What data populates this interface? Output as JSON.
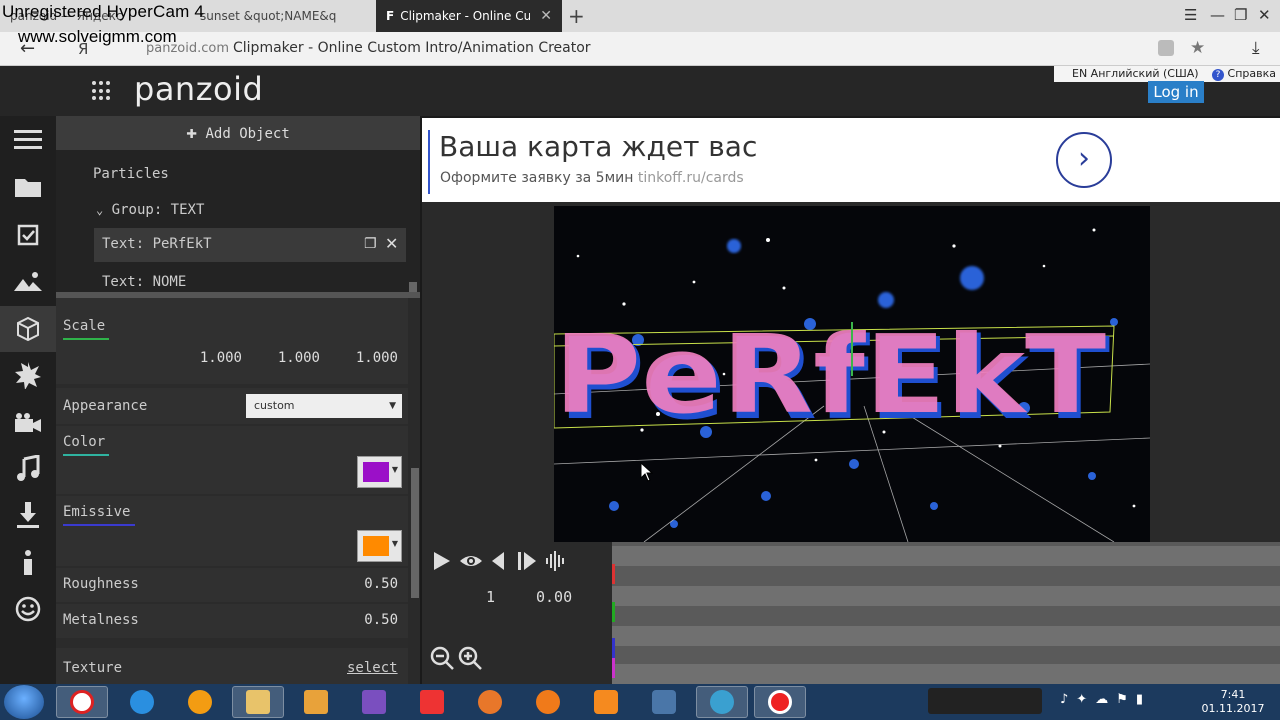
{
  "overlay": {
    "recorder_text": "Unregistered HyperCam 4",
    "recorder_url": "www.solveigmm.com"
  },
  "browser": {
    "tabs": [
      {
        "label": "panzoid — Яндекс",
        "active": false
      },
      {
        "label": "sunset &quot;NAME&q",
        "active": false
      },
      {
        "label": "Clipmaker - Online Custo",
        "active": true
      }
    ],
    "address": {
      "domain": "panzoid.com",
      "title": "Clipmaker - Online Custom Intro/Animation Creator"
    }
  },
  "header": {
    "logo": "panzoid",
    "language": "EN Английский (США)",
    "help": "Справка",
    "login": "Log in"
  },
  "panel": {
    "add_object": "Add Object",
    "tree": {
      "particles": "Particles",
      "group": "Group: TEXT",
      "selected": "Text: PeRfEkT",
      "next": "Text: NOME"
    },
    "properties": {
      "scale_label": "Scale",
      "scale_x": "1.000",
      "scale_y": "1.000",
      "scale_z": "1.000",
      "appearance_label": "Appearance",
      "appearance_value": "custom",
      "color_label": "Color",
      "color_value": "#9b10c8",
      "emissive_label": "Emissive",
      "emissive_value": "#ff8a00",
      "roughness_label": "Roughness",
      "roughness_value": "0.50",
      "metalness_label": "Metalness",
      "metalness_value": "0.50",
      "texture_label": "Texture",
      "texture_action": "select"
    }
  },
  "ad": {
    "title": "Ваша карта ждет вас",
    "subtitle": "Оформите заявку за 5мин",
    "link": "tinkoff.ru/cards"
  },
  "preview": {
    "text": "PeRfEkT"
  },
  "timeline": {
    "frame": "1",
    "time": "0.00"
  },
  "taskbar": {
    "time": "7:41",
    "date": "01.11.2017"
  },
  "colors": {
    "accent": "#2a7fc8",
    "text_pink": "#f07fc0",
    "text_blue": "#2060e0"
  }
}
